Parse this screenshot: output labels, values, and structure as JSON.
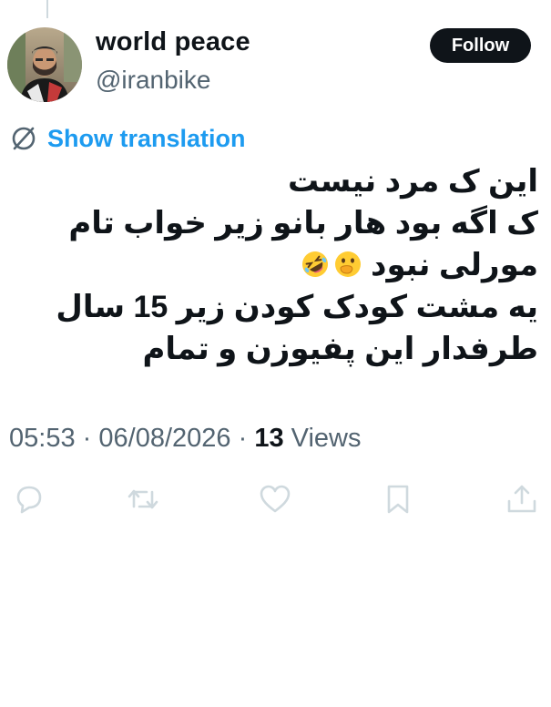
{
  "author": {
    "display_name": "world peace",
    "handle": "@iranbike"
  },
  "follow_button": {
    "label": "Follow"
  },
  "translation": {
    "label": "Show translation"
  },
  "tweet": {
    "lines": [
      "این ک مرد نیست",
      "ک اگه بود هار بانو زیر خواب تام",
      "مورلی نبود",
      "یه مشت کودک کودن زیر 15 سال",
      "طرفدار این پفیوزن و تمام"
    ]
  },
  "meta": {
    "time": "05:53",
    "date": "06/08/2026",
    "views_count": "13",
    "views_label": "Views",
    "separator": "·"
  },
  "icons": {
    "reply": "reply-icon",
    "retweet": "retweet-icon",
    "like": "heart-icon",
    "bookmark": "bookmark-icon",
    "share": "share-icon"
  },
  "colors": {
    "link": "#1d9bf0",
    "text": "#0f1419",
    "muted": "#536471",
    "icon": "#cfd9de"
  }
}
